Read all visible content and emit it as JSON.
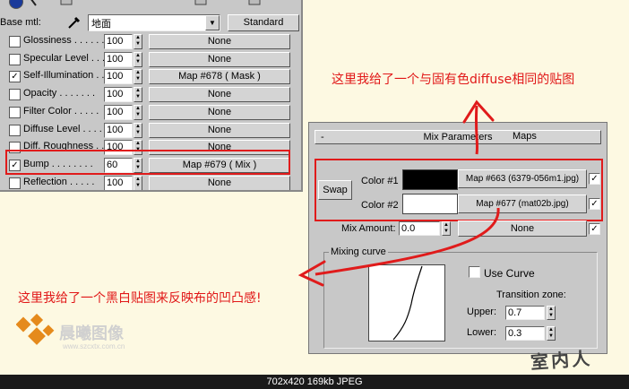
{
  "material_editor": {
    "base_label": "Base mtl:",
    "material_name": "地面",
    "type_button": "Standard",
    "rows": [
      {
        "checked": false,
        "label": "Glossiness . . . . . .",
        "value": "100",
        "map": "None"
      },
      {
        "checked": false,
        "label": "Specular Level . . .",
        "value": "100",
        "map": "None"
      },
      {
        "checked": true,
        "label": "Self-Illumination . .",
        "value": "100",
        "map": "Map #678  ( Mask )"
      },
      {
        "checked": false,
        "label": "Opacity . . . . . . .",
        "value": "100",
        "map": "None"
      },
      {
        "checked": false,
        "label": "Filter Color . . . . .",
        "value": "100",
        "map": "None"
      },
      {
        "checked": false,
        "label": "Diffuse Level . . . .",
        "value": "100",
        "map": "None"
      },
      {
        "checked": false,
        "label": "Diff. Roughness . .",
        "value": "100",
        "map": "None"
      },
      {
        "checked": true,
        "label": "Bump . . . . . . . .",
        "value": "60",
        "map": "Map #679  ( Mix )"
      },
      {
        "checked": false,
        "label": "Reflection . . . . .",
        "value": "100",
        "map": "None"
      }
    ]
  },
  "mix_params": {
    "rollout_minus": "-",
    "title": "Mix Parameters",
    "maps_header": "Maps",
    "swap_button": "Swap",
    "color1_label": "Color #1",
    "color1_swatch": "#000000",
    "color1_map": "Map #663 (6379-056m1.jpg)",
    "color2_label": "Color #2",
    "color2_swatch": "#ffffff",
    "color2_map": "Map #677 (mat02b.jpg)",
    "mix_amount_label": "Mix Amount:",
    "mix_amount_value": "0.0",
    "mix_map": "None",
    "mixing_curve_label": "Mixing curve",
    "use_curve_label": "Use Curve",
    "transition_label": "Transition zone:",
    "upper_label": "Upper:",
    "upper_value": "0.7",
    "lower_label": "Lower:",
    "lower_value": "0.3"
  },
  "annotations": {
    "top": "这里我给了一个与固有色diffuse相同的贴图",
    "bottom": "这里我给了一个黑白贴图来反映布的凹凸感!"
  },
  "watermark": {
    "logo_text": "晨曦图像",
    "url": "www.szcxtx.com.cn"
  },
  "signature": "室内人",
  "footer": "702x420  169kb  JPEG",
  "colors": {
    "annotation_red": "#e01b1b",
    "panel_gray": "#c8c8c8",
    "background": "#fdf9e2"
  }
}
